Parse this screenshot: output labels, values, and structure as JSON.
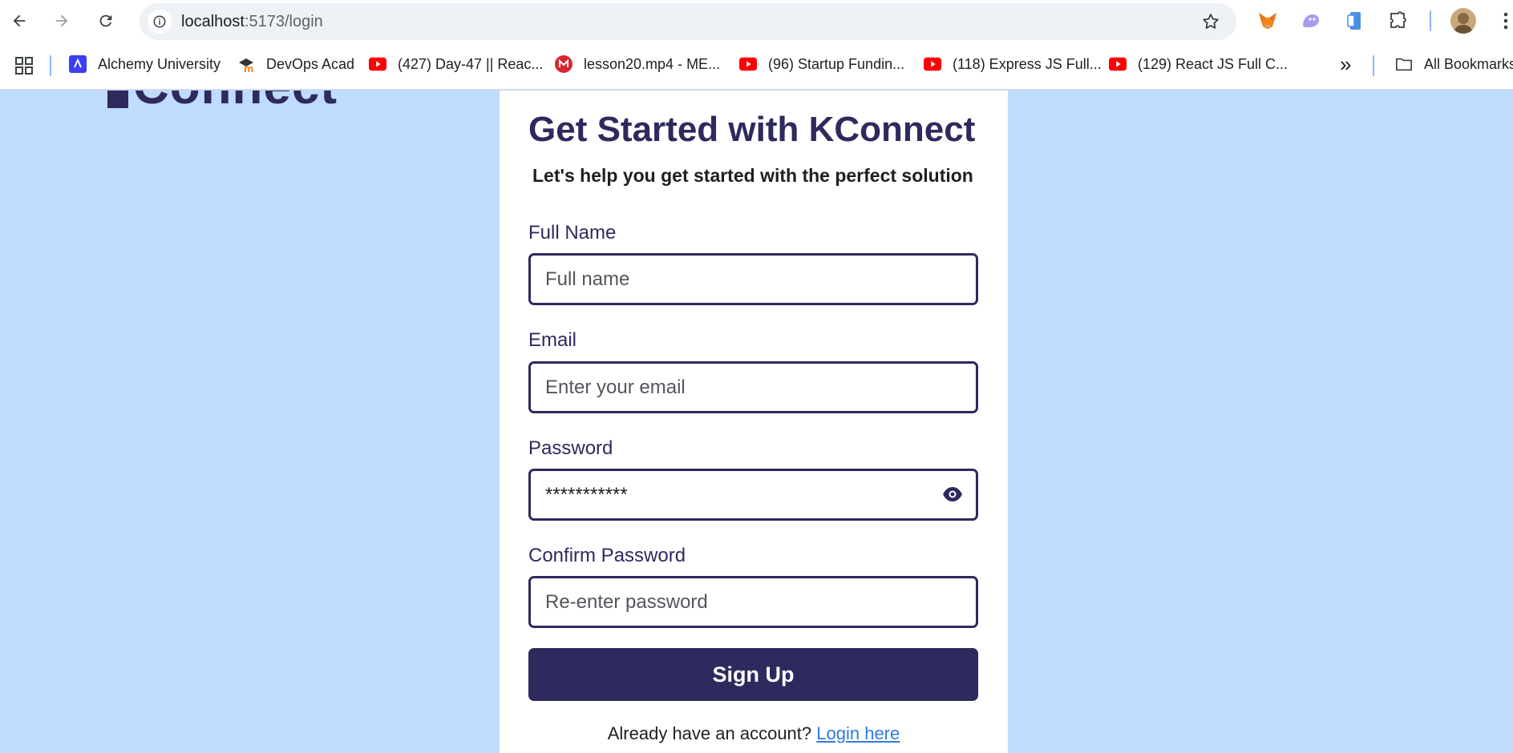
{
  "browser": {
    "url_host": "localhost",
    "url_path": ":5173/login",
    "bookmarks": [
      {
        "label": "Alchemy University",
        "icon": "alchemy-icon"
      },
      {
        "label": "DevOps Acad",
        "icon": "devops-icon"
      },
      {
        "label": "(427) Day-47 || Reac...",
        "icon": "youtube-icon"
      },
      {
        "label": "lesson20.mp4 - ME...",
        "icon": "mega-icon"
      },
      {
        "label": "(96) Startup Fundin...",
        "icon": "youtube-icon"
      },
      {
        "label": "(118) Express JS Full...",
        "icon": "youtube-icon"
      },
      {
        "label": "(129) React JS Full C...",
        "icon": "youtube-icon"
      }
    ],
    "more_label": "»",
    "all_bookmarks": "All Bookmarks"
  },
  "page": {
    "logo_text": "Connect",
    "title": "Get Started with KConnect",
    "subtitle": "Let's help you get started with the perfect solution",
    "fields": {
      "full_name": {
        "label": "Full Name",
        "placeholder": "Full name",
        "value": ""
      },
      "email": {
        "label": "Email",
        "placeholder": "Enter your email",
        "value": ""
      },
      "password": {
        "label": "Password",
        "placeholder": "",
        "value": "***********"
      },
      "confirm": {
        "label": "Confirm Password",
        "placeholder": "Re-enter password",
        "value": ""
      }
    },
    "submit_label": "Sign Up",
    "footer_prompt": "Already have an account?",
    "footer_link": "Login here"
  },
  "colors": {
    "background": "#bfdbfe",
    "primary": "#2e2a5e",
    "link": "#2f7be0"
  }
}
